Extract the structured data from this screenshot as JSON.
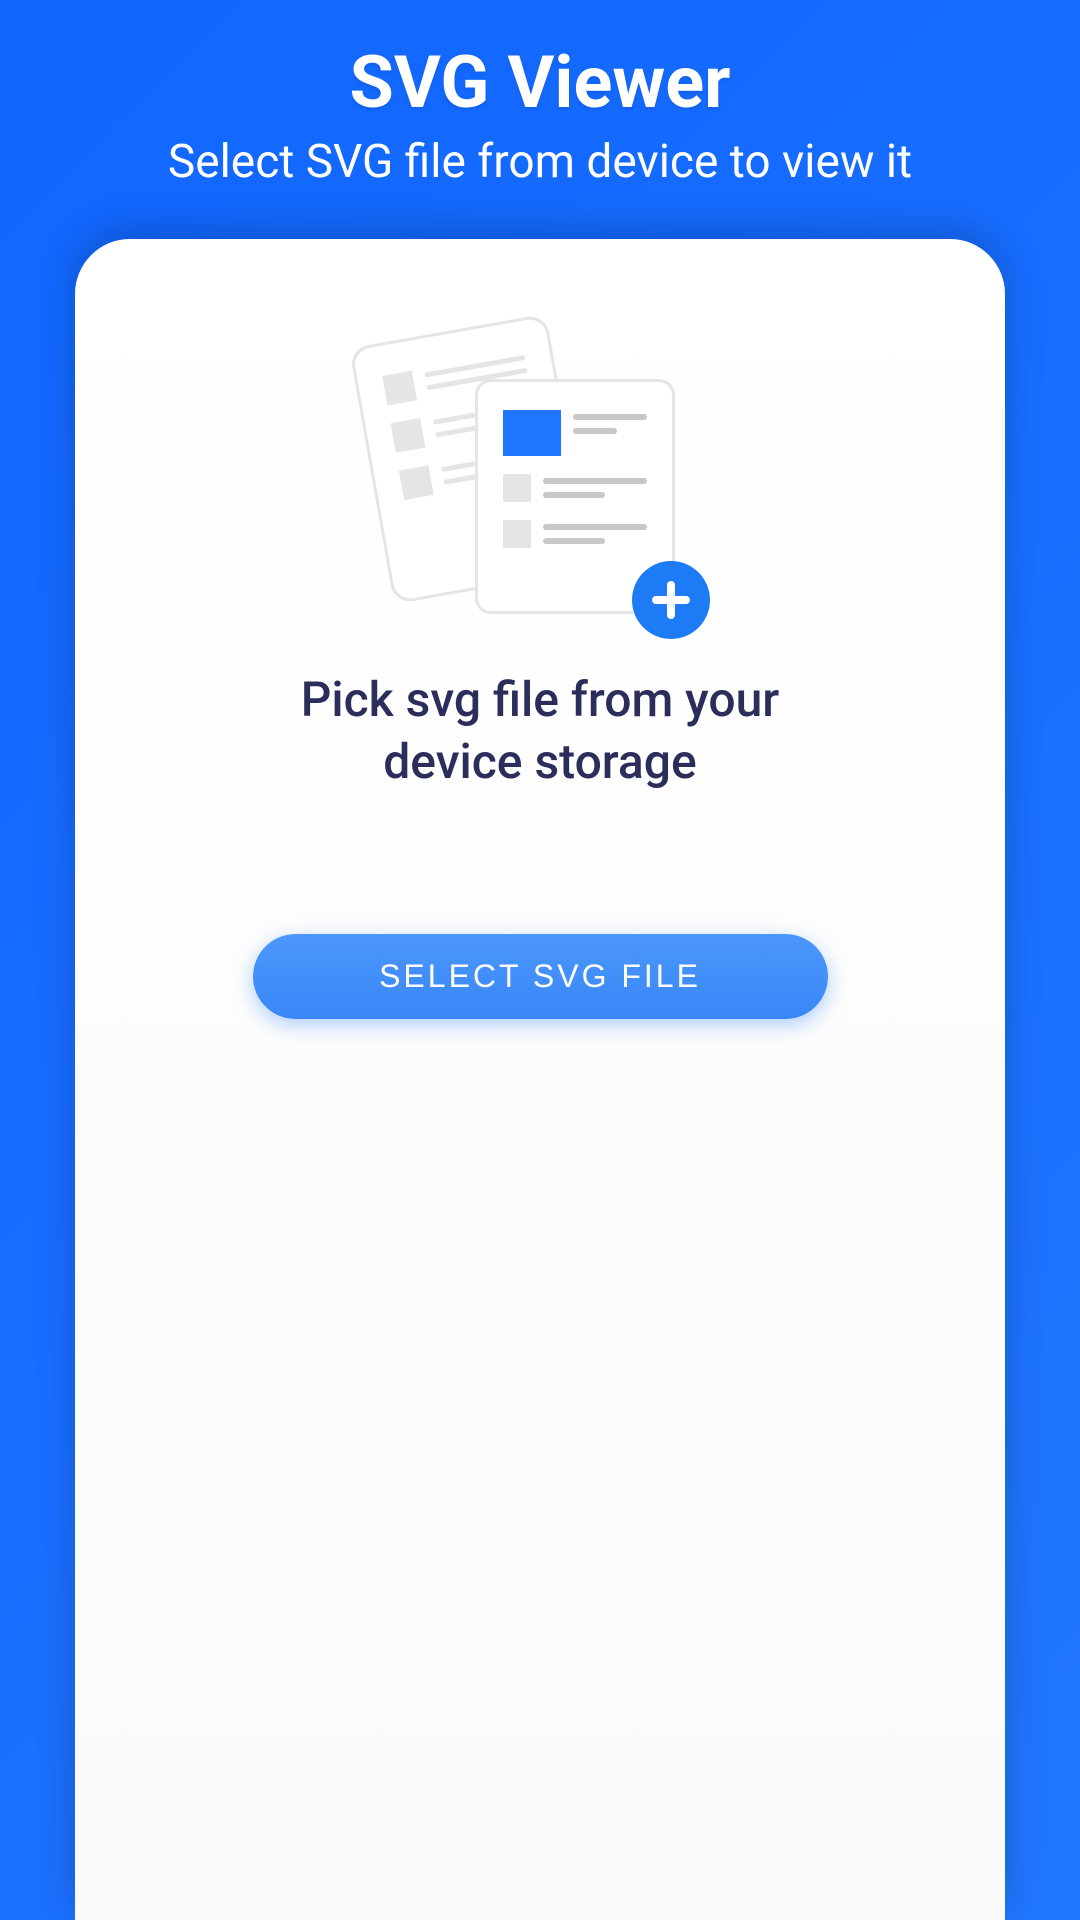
{
  "header": {
    "title": "SVG Viewer",
    "subtitle": "Select SVG file from device to view it"
  },
  "card": {
    "instruction": "Pick svg file from your device storage",
    "select_button_label": "SELECT SVG FILE"
  },
  "icons": {
    "plus": "plus-icon",
    "documents": "documents-icon"
  }
}
